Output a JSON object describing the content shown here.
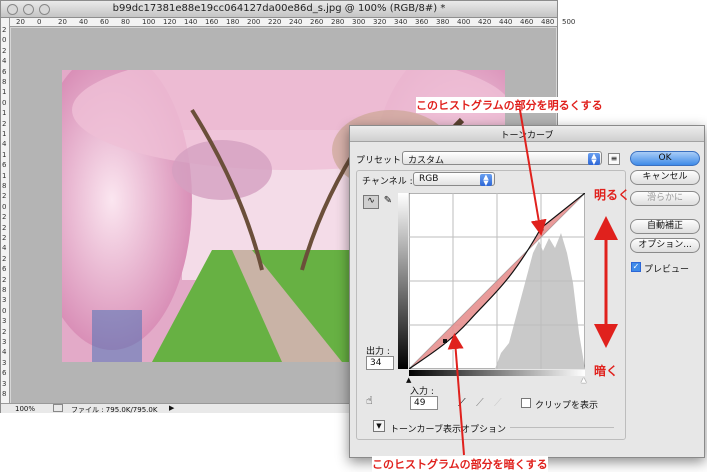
{
  "document": {
    "title": "b99dc17381e88e19cc064127da00e86d_s.jpg @ 100% (RGB/8#) *",
    "ruler_top": [
      "20",
      "0",
      "20",
      "40",
      "60",
      "80",
      "100",
      "120",
      "140",
      "160",
      "180",
      "200",
      "220",
      "240",
      "260",
      "280",
      "300",
      "320",
      "340",
      "360",
      "380",
      "400",
      "420",
      "440",
      "460",
      "480",
      "500"
    ],
    "ruler_left": [
      "2",
      "0",
      "2",
      "4",
      "6",
      "8",
      "1",
      "0",
      "1",
      "2",
      "1",
      "4",
      "1",
      "6",
      "1",
      "8",
      "2",
      "0",
      "2",
      "2",
      "2",
      "4",
      "2",
      "6",
      "2",
      "8",
      "3",
      "0",
      "3",
      "2",
      "3",
      "4",
      "3",
      "6",
      "3",
      "8"
    ],
    "zoom": "100%",
    "file_info": "ファイル : 795.0K/795.0K"
  },
  "curves": {
    "title": "トーンカーブ",
    "preset_label": "プリセット :",
    "preset_value": "カスタム",
    "channel_label": "チャンネル :",
    "channel_value": "RGB",
    "output_label": "出力 :",
    "output_value": "34",
    "input_label": "入力 :",
    "input_value": "49",
    "clip_label": "クリップを表示",
    "options_label": "トーンカーブ表示オプション",
    "buttons": {
      "ok": "OK",
      "cancel": "キャンセル",
      "smooth": "滑らかに",
      "auto": "自動補正",
      "options": "オプション...",
      "preview": "プレビュー"
    }
  },
  "annotations": {
    "brighten_note": "このヒストグラムの部分を明るくする",
    "darken_note": "このヒストグラムの部分を暗くする",
    "bright_label": "明るく",
    "dark_label": "暗く",
    "accent": "#e0211d"
  }
}
